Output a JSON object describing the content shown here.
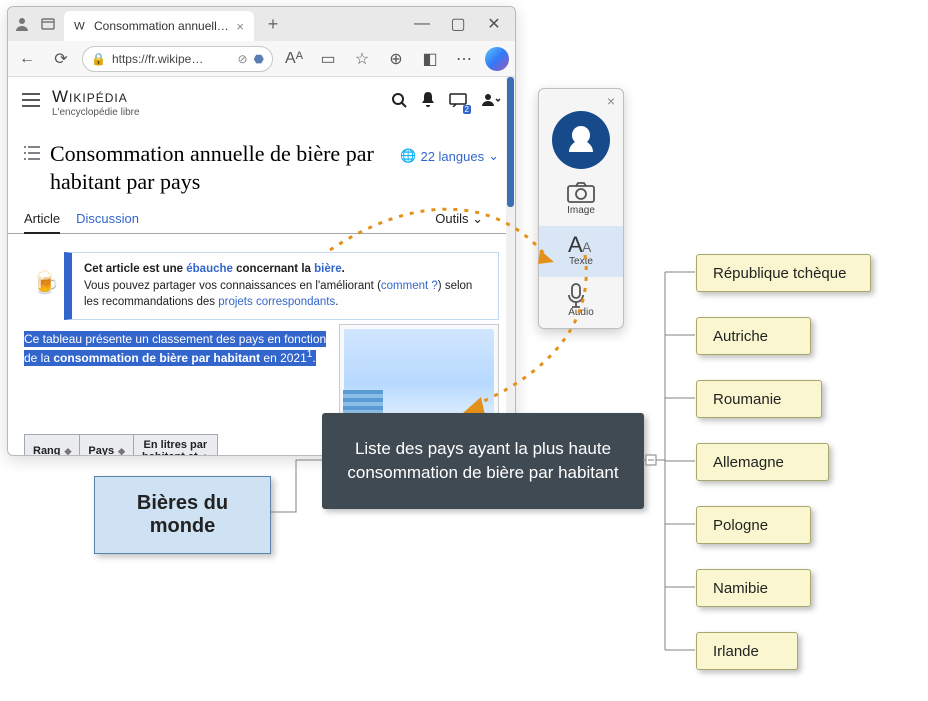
{
  "browser": {
    "tab_title": "Consommation annuelle de bièr…",
    "url_display": "https://fr.wikipe…",
    "toolbar_glyphs": {
      "back": "←",
      "reload": "⟳",
      "aa": "Aᴬ",
      "read": "▭",
      "star": "☆",
      "ext": "⊕",
      "split": "◧",
      "more": "⋯"
    }
  },
  "wiki": {
    "site_name": "Wikipédia",
    "site_tag": "L'encyclopédie libre",
    "page_title": "Consommation annuelle de bière par habitant par pays",
    "lang_count": "22 langues",
    "tabs": {
      "article": "Article",
      "discussion": "Discussion",
      "tools": "Outils"
    },
    "notice_lead": "Cet article est une ",
    "notice_link1": "ébauche",
    "notice_mid": " concernant la ",
    "notice_link2": "bière",
    "notice_line2a": "Vous pouvez partager vos connaissances en l'améliorant (",
    "notice_comment": "comment ?",
    "notice_line2b": ") selon les recommandations des ",
    "notice_link3": "projets correspondants",
    "intro_a": "Ce tableau présente un classement des pays en fonction de la ",
    "intro_b": "consommation de bière par habitant",
    "intro_c": " en 2021",
    "intro_ref": "1",
    "intro_end": ".",
    "table": {
      "rank": "Rang",
      "country": "Pays",
      "liters_l1": "En litres par",
      "liters_l2": "habitant et"
    },
    "notif_badge": "2"
  },
  "companion": {
    "image": "Image",
    "texte": "Texte",
    "audio": "Audio"
  },
  "mindmap": {
    "root": "Bières du monde",
    "center": "Liste des pays ayant la plus haute consommation de bière par habitant",
    "leaves": [
      "République tchèque",
      "Autriche",
      "Roumanie",
      "Allemagne",
      "Pologne",
      "Namibie",
      "Irlande"
    ]
  }
}
